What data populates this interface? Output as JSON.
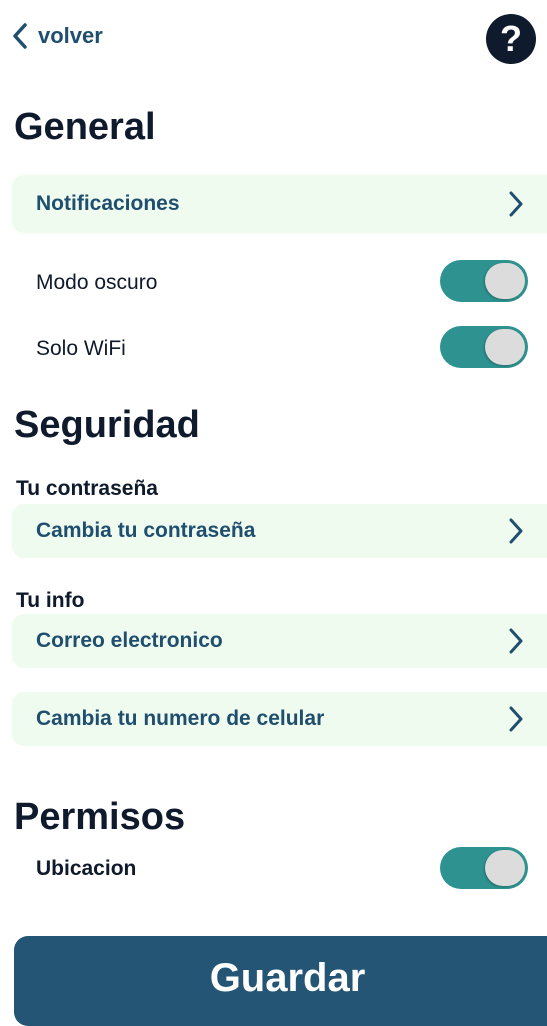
{
  "header": {
    "back_label": "volver",
    "back_icon": "chevron-left-icon",
    "help_glyph": "?",
    "help_icon": "question-mark-icon"
  },
  "general": {
    "title": "General",
    "notifications_label": "Notificaciones",
    "toggles": [
      {
        "label": "Modo oscuro",
        "on": true
      },
      {
        "label": "Solo WiFi",
        "on": true
      }
    ]
  },
  "security": {
    "title": "Seguridad",
    "password_section_label": "Tu contraseña",
    "change_password_label": "Cambia tu contraseña",
    "info_section_label": "Tu  info",
    "email_label": "Correo electronico",
    "change_phone_label": "Cambia tu numero de celular"
  },
  "permissions": {
    "title": "Permisos",
    "location": {
      "label": "Ubicacion",
      "on": true
    }
  },
  "save_label": "Guardar",
  "colors": {
    "accent_toggle": "#2e9390",
    "row_background": "#eefbee",
    "primary_button": "#245574",
    "link_text": "#1f4e6e"
  }
}
